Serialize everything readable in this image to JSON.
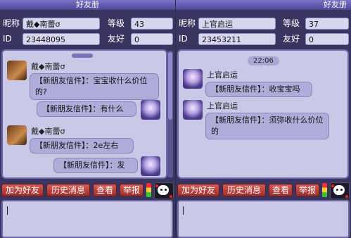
{
  "left": {
    "title": "好友册",
    "nickname_label": "昵称",
    "nickname": "戴◆南蕾σ",
    "level_label": "等级",
    "level": "43",
    "id_label": "ID",
    "id": "23448095",
    "friendship_label": "友好",
    "friendship": "0",
    "messages": [
      {
        "sender": "戴◆南蕾σ",
        "text": "【新朋友信件】：宝宝收什么价位的?"
      },
      {
        "sender": "",
        "text": "【新朋友信件】：有什么"
      },
      {
        "sender": "戴◆南蕾σ",
        "text": "【新朋友信件】：2e左右"
      },
      {
        "sender": "",
        "text": "【新朋友信件】：发"
      }
    ],
    "buttons": {
      "add": "加为好友",
      "history": "历史消息",
      "view": "查看",
      "report": "举报"
    }
  },
  "right": {
    "title": "好友册",
    "nickname_label": "昵称",
    "nickname": "上官启运",
    "level_label": "等级",
    "level": "37",
    "id_label": "ID",
    "id": "23453211",
    "friendship_label": "友好",
    "friendship": "0",
    "time": "22:06",
    "messages": [
      {
        "sender": "上官启运",
        "text": "【新朋友信件】：收宝宝吗"
      },
      {
        "sender": "上官启运",
        "text": "【新朋友信件】：须弥收什么价位的"
      }
    ],
    "buttons": {
      "add": "加为好友",
      "history": "历史消息",
      "view": "查看",
      "report": "举报"
    }
  },
  "colors": {
    "panel": "#3a3560",
    "chat_bg": "#cac8e7",
    "bubble": "#b0acda",
    "button": "#c0403c"
  },
  "icons": [
    "male-avatar-icon",
    "female-avatar-icon",
    "signal-meter-icon",
    "pet-icon"
  ]
}
